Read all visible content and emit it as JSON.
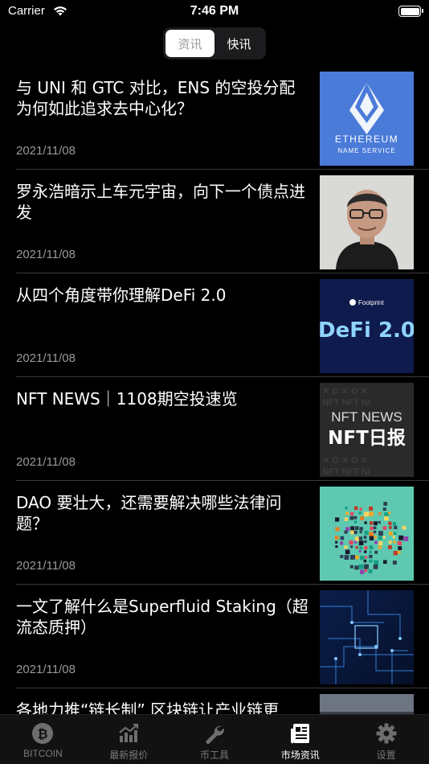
{
  "status": {
    "carrier": "Carrier",
    "time": "7:46 PM"
  },
  "segment": {
    "tabs": [
      {
        "label": "资讯",
        "active": true
      },
      {
        "label": "快讯",
        "active": false
      }
    ]
  },
  "news": [
    {
      "title": "与 UNI 和 GTC 对比，ENS 的空投分配为何如此追求去中心化？",
      "date": "2021/11/08",
      "thumb": {
        "kind": "ens",
        "line1": "ETHEREUM",
        "line2": "NAME SERVICE"
      }
    },
    {
      "title": "罗永浩暗示上车元宇宙，向下一个债点进发",
      "date": "2021/11/08",
      "thumb": {
        "kind": "portrait"
      }
    },
    {
      "title": "从四个角度带你理解DeFi 2.0",
      "date": "2021/11/08",
      "thumb": {
        "kind": "defi",
        "brand": "Footprint",
        "headline": "DeFi 2.0"
      }
    },
    {
      "title": "NFT NEWS｜1108期空投速览",
      "date": "2021/11/08",
      "thumb": {
        "kind": "nft",
        "line1": "NFT NEWS",
        "line2": "NFT日报"
      }
    },
    {
      "title": "DAO 要壮大，还需要解决哪些法律问题？",
      "date": "2021/11/08",
      "thumb": {
        "kind": "dao"
      }
    },
    {
      "title": "一文了解什么是Superfluid Staking（超流态质押）",
      "date": "2021/11/08",
      "thumb": {
        "kind": "circuit"
      }
    },
    {
      "title": "各地力推“链长制” 区块链让产业链更",
      "date": "",
      "thumb": {
        "kind": "partial"
      }
    }
  ],
  "tabbar": {
    "items": [
      {
        "label": "BITCOIN",
        "icon": "bitcoin-icon",
        "active": false
      },
      {
        "label": "最新报价",
        "icon": "chart-icon",
        "active": false
      },
      {
        "label": "币工具",
        "icon": "wrench-icon",
        "active": false
      },
      {
        "label": "市场资讯",
        "icon": "newspaper-icon",
        "active": true
      },
      {
        "label": "设置",
        "icon": "gear-icon",
        "active": false
      }
    ]
  },
  "colors": {
    "background": "#000000",
    "text": "#ffffff",
    "muted": "#9a9a9a",
    "divider": "#3a3a3c",
    "ens_blue": "#4a7bd9",
    "defi_navy": "#0f1b4d",
    "dao_teal": "#5ec9b0"
  }
}
